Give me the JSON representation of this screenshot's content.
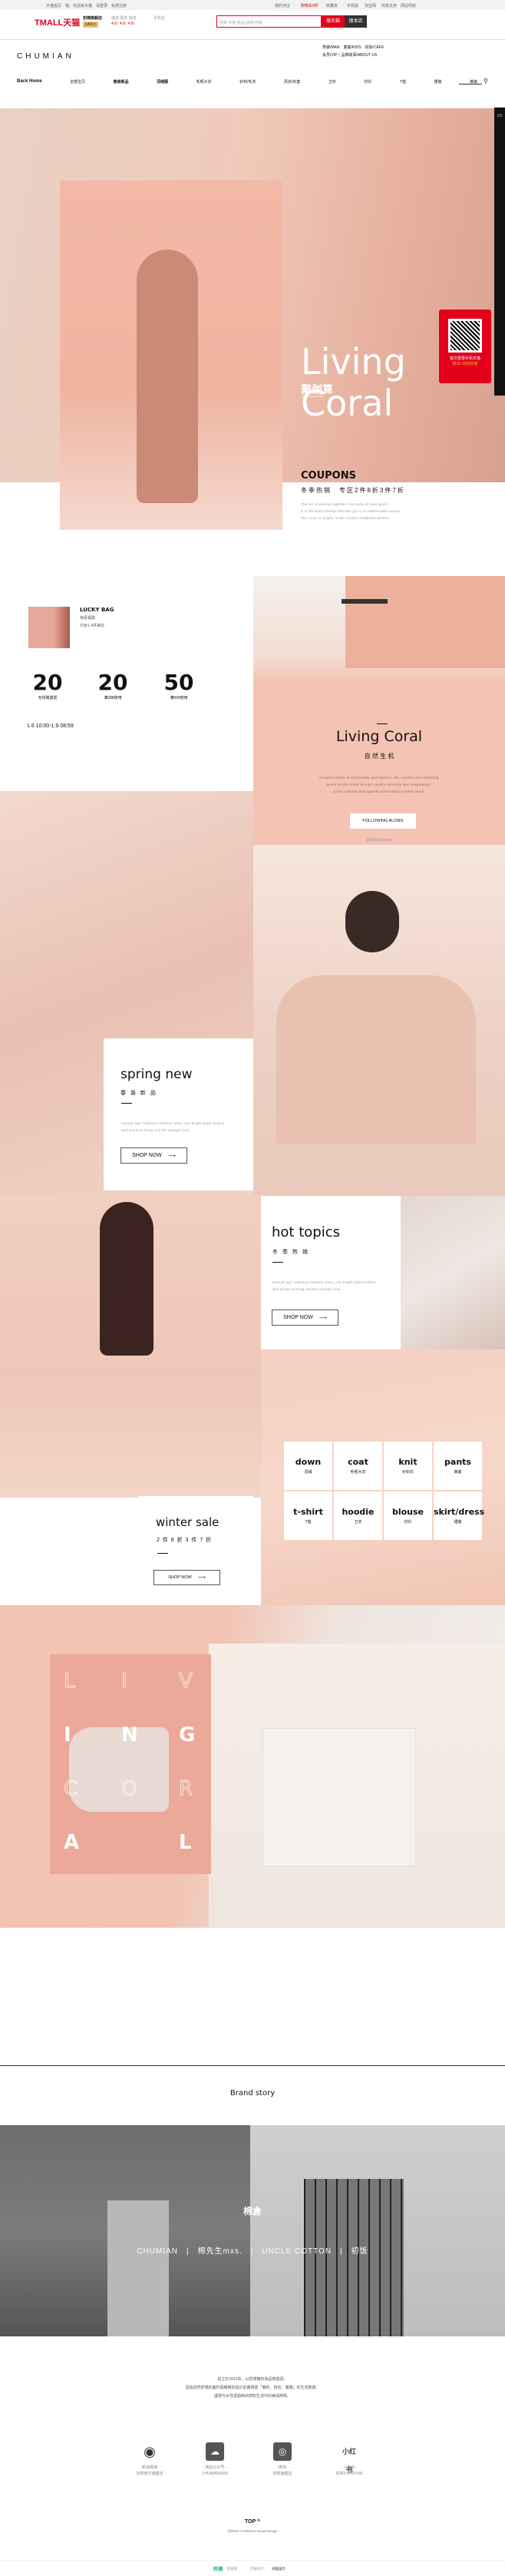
{
  "topbar": {
    "left": [
      "天猫首页",
      "喵，欢迎来天猫",
      "请登录",
      "免费注册"
    ],
    "right": [
      "我的淘宝",
      "购物车0件",
      "收藏夹",
      "手机版",
      "淘宝网",
      "商家支持",
      "网站导航"
    ]
  },
  "header": {
    "logo": "TMALL天猫",
    "shop_name": "初棉旗舰店",
    "shop_badge": "品牌官方",
    "ratings_label": "描述 服务 物流",
    "ratings": "4.8↑ 4.8↑ 4.8↑",
    "mobile_label": "手机店",
    "search_placeholder": "搜索 天猫 商品/品牌/店铺",
    "search_tmall": "搜天猫",
    "search_shop": "搜本店"
  },
  "brand": {
    "logo": "CHUMIAN",
    "links_row1": "男装/MAN　童装/KIDS　初饭/CAFE",
    "links_row2": "会员/VIP丨品牌故事/ABOUT US"
  },
  "nav": [
    "Back Home",
    "全部宝贝",
    "春装新品",
    "羽绒服",
    "毛呢大衣",
    "针织/毛衣",
    "风衣/外套",
    "卫衣",
    "衬衫",
    "T恤",
    "裙装",
    "裤装"
  ],
  "hero": {
    "title": "Living Coral",
    "juhuasuan": "聚划算",
    "juhuasuan_url": "-juhuasuan.com-",
    "qr_line1": "首次登录手机天猫",
    "qr_line2": "抢10-15元红包",
    "coupons": "COUPONS",
    "coupons_sub": "冬季热销　专区2件8折3件7折",
    "para": [
      "The art of joining together, the style of case grain ,",
      "it is the bold attempt that the girl is in fashionable arena.",
      "The color is bright, is the crowd's brightest person."
    ]
  },
  "lucky": {
    "title": "LUCKY BAG",
    "line1": "惊喜福袋",
    "line2": "内含1-4件美衣",
    "coupons": [
      {
        "value": "20",
        "label": "无线端激发"
      },
      {
        "value": "20",
        "label": "满288使用"
      },
      {
        "value": "50",
        "label": "满599使用"
      }
    ],
    "time": "1.6 10:00-1.9 08:59"
  },
  "coral": {
    "title": "Living Coral",
    "sub": "自 然 生 机",
    "para": [
      "Creative prints of personality and fashion, the colorful and intersting",
      "prints on the chest are girl' quaint curiosity and imagination.",
      "Color contrast and special prints add a stylish touch."
    ],
    "button": "FOLLOWING ALONG",
    "tag": "@spring theme"
  },
  "spring": {
    "title": "spring new",
    "sub": "春 装 新 品",
    "para": [
      "Casual age reduction fashion retro, use bright plaid stripes",
      "and prints to bring out the vintage look."
    ],
    "button": "SHOP NOW"
  },
  "hot": {
    "title": "hot topics",
    "sub": "冬 季 热 销",
    "para": [
      "Casual age reduction fashion retro, use bright plaid stripes",
      "and prints to bring out the vintage look."
    ],
    "button": "SHOP NOW"
  },
  "categories": [
    {
      "en": "down",
      "cn": "羽绒"
    },
    {
      "en": "coat",
      "cn": "毛呢大衣"
    },
    {
      "en": "knit",
      "cn": "针织衫"
    },
    {
      "en": "pants",
      "cn": "裤装"
    },
    {
      "en": "t-shirt",
      "cn": "T恤"
    },
    {
      "en": "hoodie",
      "cn": "卫衣"
    },
    {
      "en": "blouse",
      "cn": "衬衫"
    },
    {
      "en": "skirt/dress",
      "cn": "裙装"
    }
  ],
  "winter": {
    "title": "winter sale",
    "sub": "2 件 8 折 3 件 7 折",
    "button": "SHOP NOW"
  },
  "poster": {
    "letters": [
      "L",
      "I",
      "V",
      "I",
      "N",
      "G",
      "C",
      "O",
      "R",
      "A",
      "",
      "L"
    ]
  },
  "story": {
    "title": "Brand story",
    "center_logo": "棉倉",
    "brands": "CHUMIAN　|　棉先生mxs.　|　UNCLE COTTON　|　初饭",
    "para": [
      "創立於2012年，以舒適簡約為品牌基調。",
      "透過自然舒適的面料與精緻的設計剪裁傳遞「簡約、自信、優雅」的生活態度。",
      "讓當代女性透過時尚感知生活中的美與熱情。"
    ]
  },
  "social": [
    {
      "icon": "weibo-icon",
      "name": "- 新浪微博 -",
      "id": "初棉官方旗舰店"
    },
    {
      "icon": "wechat-icon",
      "name": "- 微信公众号 -",
      "id": "CHUMIAN1803"
    },
    {
      "icon": "weitao-icon",
      "name": "- 微淘 -",
      "id": "初棉旗舰店"
    },
    {
      "icon": "xiaohongshu-icon",
      "name": "- 小红书 -",
      "id": "初棉278397086",
      "logo": "小红书"
    }
  ],
  "footer": {
    "top": "TOP ^",
    "copyright": "@2018 CHUMIAN Visual Design",
    "wangpu": "旺铺",
    "edition": "智能版",
    "design_label": "店铺设计：",
    "designer": "天猫设计"
  },
  "colors": {
    "tmall_red": "#e2001a",
    "coral": "#f4c3b3"
  }
}
